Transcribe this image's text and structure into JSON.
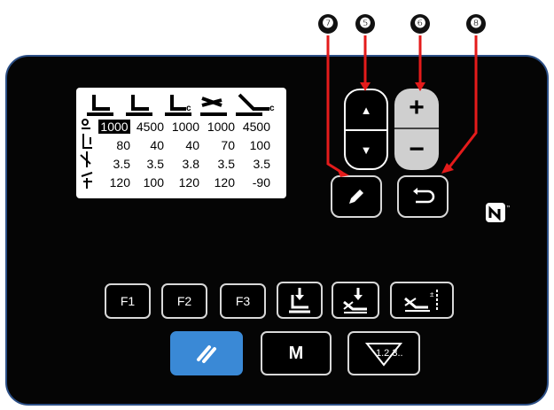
{
  "callouts": [
    "❼",
    "❺",
    "❻",
    "❽"
  ],
  "lcd": {
    "header_icons": [
      "presser-foot-icon",
      "presser-foot-left-icon",
      "presser-foot-c-icon",
      "stitch-icon",
      "thread-c-icon"
    ],
    "rows": [
      {
        "icon": "speed-icon",
        "values": [
          "1000",
          "4500",
          "1000",
          "1000",
          "4500"
        ],
        "selected": 0
      },
      {
        "icon": "foot-lift-icon",
        "values": [
          "80",
          "40",
          "40",
          "70",
          "100"
        ]
      },
      {
        "icon": "stitch-length-icon",
        "values": [
          "3.5",
          "3.5",
          "3.8",
          "3.5",
          "3.5"
        ]
      },
      {
        "icon": "tension-icon",
        "values": [
          "120",
          "100",
          "120",
          "120",
          "-90"
        ]
      }
    ]
  },
  "keys": {
    "up": "▲",
    "down": "▼",
    "plus": "+",
    "minus": "−",
    "f1": "F1",
    "f2": "F2",
    "f3": "F3",
    "m": "M",
    "counter": "1.2.3.."
  },
  "nfc_label": "N"
}
